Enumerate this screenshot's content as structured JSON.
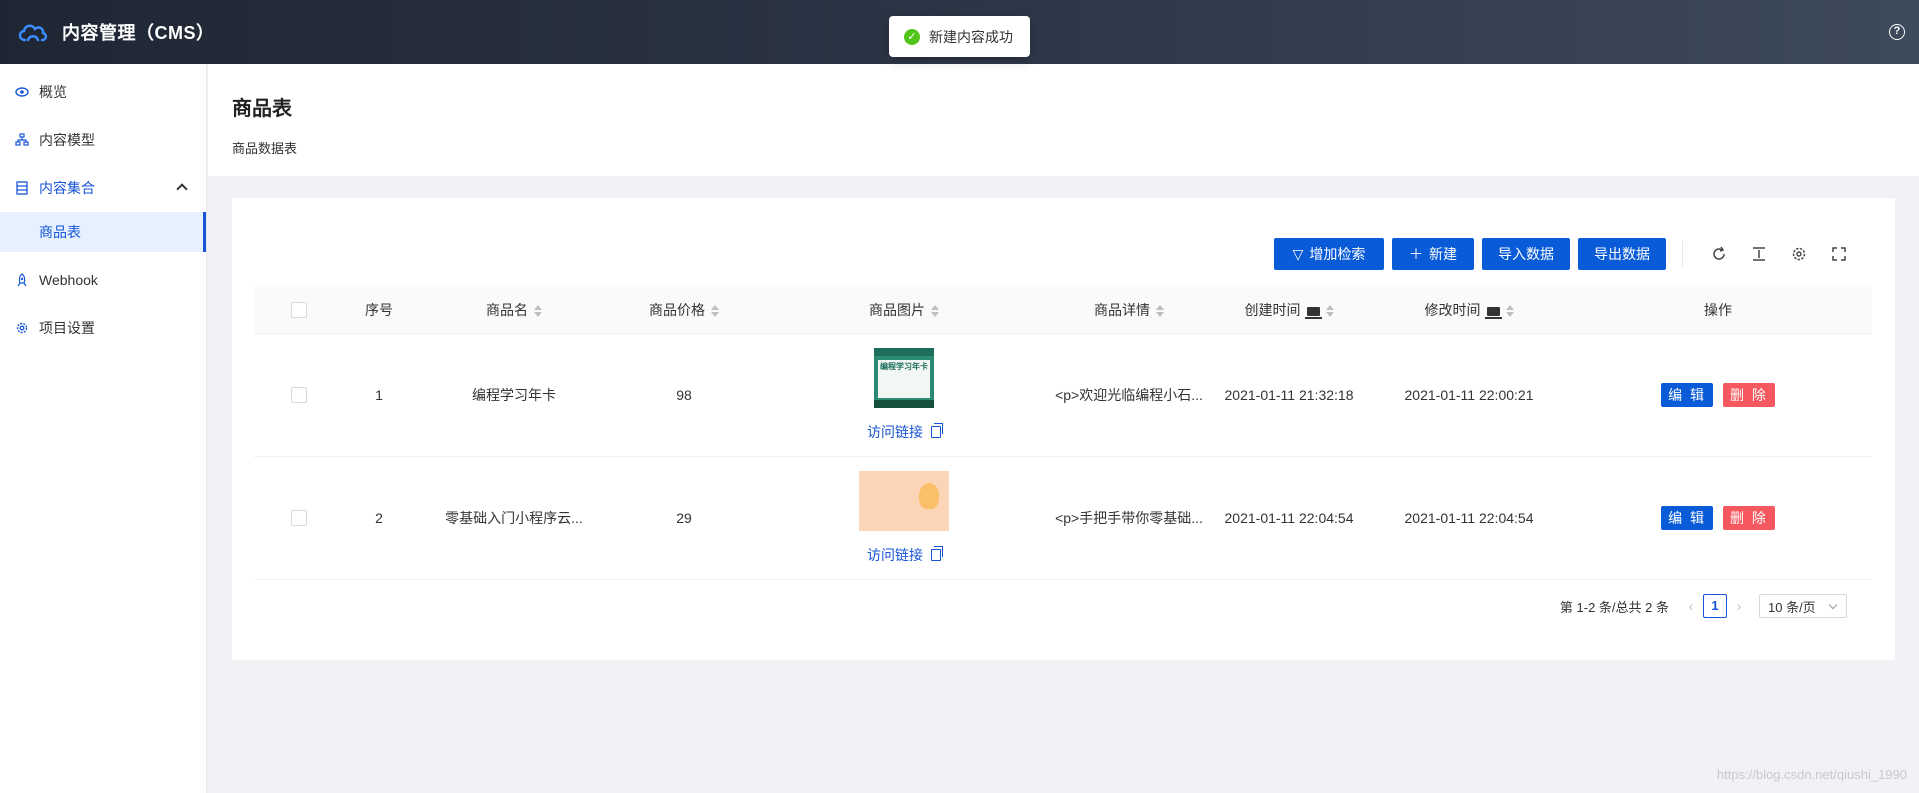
{
  "header": {
    "title": "内容管理（CMS）",
    "help_icon": "question-circle-icon"
  },
  "toast": {
    "text": "新建内容成功",
    "icon": "check-circle-icon",
    "color": "#52c41a"
  },
  "sidebar": {
    "items": [
      {
        "label": "概览",
        "icon": "eye-icon"
      },
      {
        "label": "内容模型",
        "icon": "sitemap-icon"
      },
      {
        "label": "内容集合",
        "icon": "database-icon",
        "expanded": true
      },
      {
        "label": "商品表",
        "active": true
      },
      {
        "label": "Webhook",
        "icon": "rocket-icon"
      },
      {
        "label": "项目设置",
        "icon": "gear-icon"
      }
    ]
  },
  "page": {
    "title": "商品表",
    "description": "商品数据表"
  },
  "toolbar": {
    "search_label": "增加检索",
    "new_label": "新建",
    "import_label": "导入数据",
    "export_label": "导出数据"
  },
  "table": {
    "columns": [
      "序号",
      "商品名",
      "商品价格",
      "商品图片",
      "商品详情",
      "创建时间",
      "修改时间",
      "操作"
    ],
    "rows": [
      {
        "index": "1",
        "name": "编程学习年卡",
        "price": "98",
        "link": "访问链接",
        "detail": "<p>欢迎光临编程小石...",
        "created": "2021-01-11 21:32:18",
        "modified": "2021-01-11 22:00:21",
        "image_caption": "编程学习年卡"
      },
      {
        "index": "2",
        "name": "零基础入门小程序云...",
        "price": "29",
        "link": "访问链接",
        "detail": "<p>手把手带你零基础...",
        "created": "2021-01-11 22:04:54",
        "modified": "2021-01-11 22:04:54"
      }
    ],
    "edit_label": "编 辑",
    "delete_label": "删 除"
  },
  "pagination": {
    "summary": "第 1-2 条/总共 2 条",
    "current": "1",
    "page_size": "10 条/页"
  },
  "watermark": "https://blog.csdn.net/qiushi_1990",
  "colors": {
    "primary": "#0a5bd8",
    "danger": "#f5585f",
    "header_dark": "#1f2633"
  }
}
